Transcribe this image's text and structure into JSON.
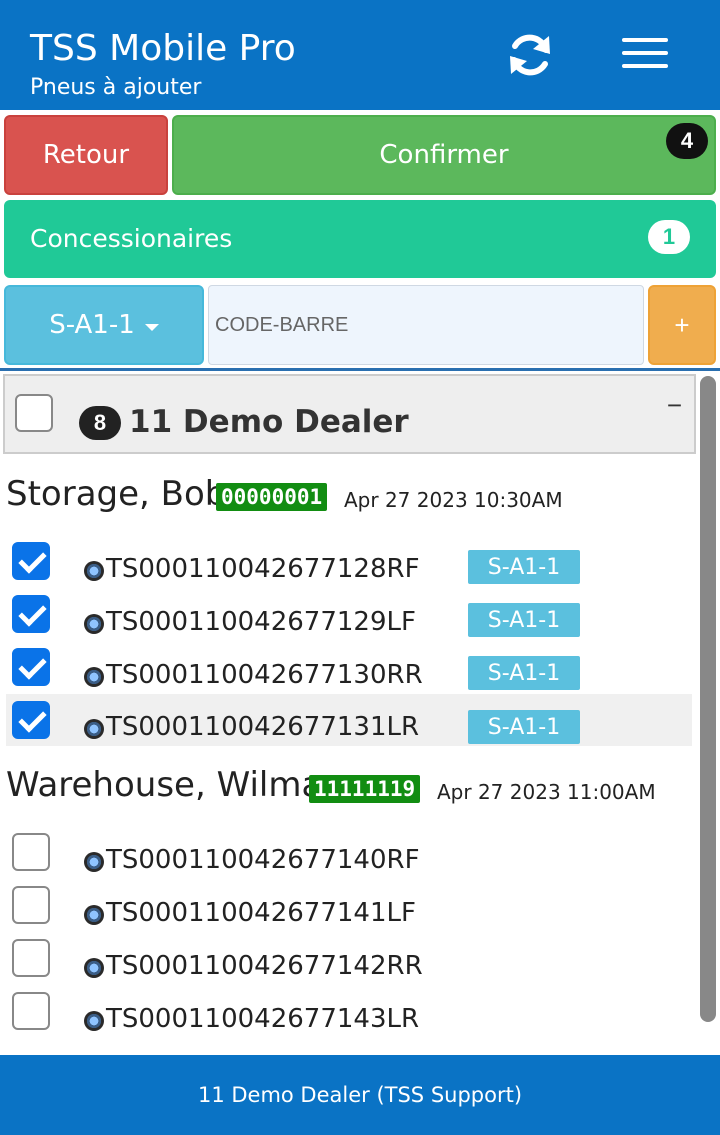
{
  "header": {
    "title": "TSS Mobile Pro",
    "subtitle": "Pneus à ajouter",
    "refresh_icon": "refresh-icon",
    "menu_icon": "hamburger-menu-icon"
  },
  "actions": {
    "back_label": "Retour",
    "confirm_label": "Confirmer",
    "confirm_count": "4"
  },
  "dealers": {
    "label": "Concessionaires",
    "count": "1"
  },
  "scan": {
    "location": "S-A1-1",
    "barcode_placeholder": "CODE-BARRE",
    "add_label": "+"
  },
  "dealer_panel": {
    "count": "8",
    "name": "11 Demo Dealer",
    "collapse": "−"
  },
  "groups": [
    {
      "name": "Storage, Bob",
      "account": "00000001",
      "timestamp": "Apr 27 2023 10:30AM",
      "tires": [
        {
          "code": "TS000110042677128RF",
          "location": "S-A1-1",
          "checked": true
        },
        {
          "code": "TS000110042677129LF",
          "location": "S-A1-1",
          "checked": true
        },
        {
          "code": "TS000110042677130RR",
          "location": "S-A1-1",
          "checked": true
        },
        {
          "code": "TS000110042677131LR",
          "location": "S-A1-1",
          "checked": true
        }
      ]
    },
    {
      "name": "Warehouse, Wilma",
      "account": "11111119",
      "timestamp": "Apr 27 2023 11:00AM",
      "tires": [
        {
          "code": "TS000110042677140RF",
          "location": "",
          "checked": false
        },
        {
          "code": "TS000110042677141LF",
          "location": "",
          "checked": false
        },
        {
          "code": "TS000110042677142RR",
          "location": "",
          "checked": false
        },
        {
          "code": "TS000110042677143LR",
          "location": "",
          "checked": false
        }
      ]
    }
  ],
  "footer": {
    "text": "11 Demo Dealer (TSS Support)"
  },
  "colors": {
    "primary": "#0a73c5",
    "danger": "#d9534f",
    "success": "#5cb85c",
    "teal": "#20c997",
    "info": "#5bc0de",
    "warning": "#f0ad4e",
    "account_badge": "#128d12"
  }
}
